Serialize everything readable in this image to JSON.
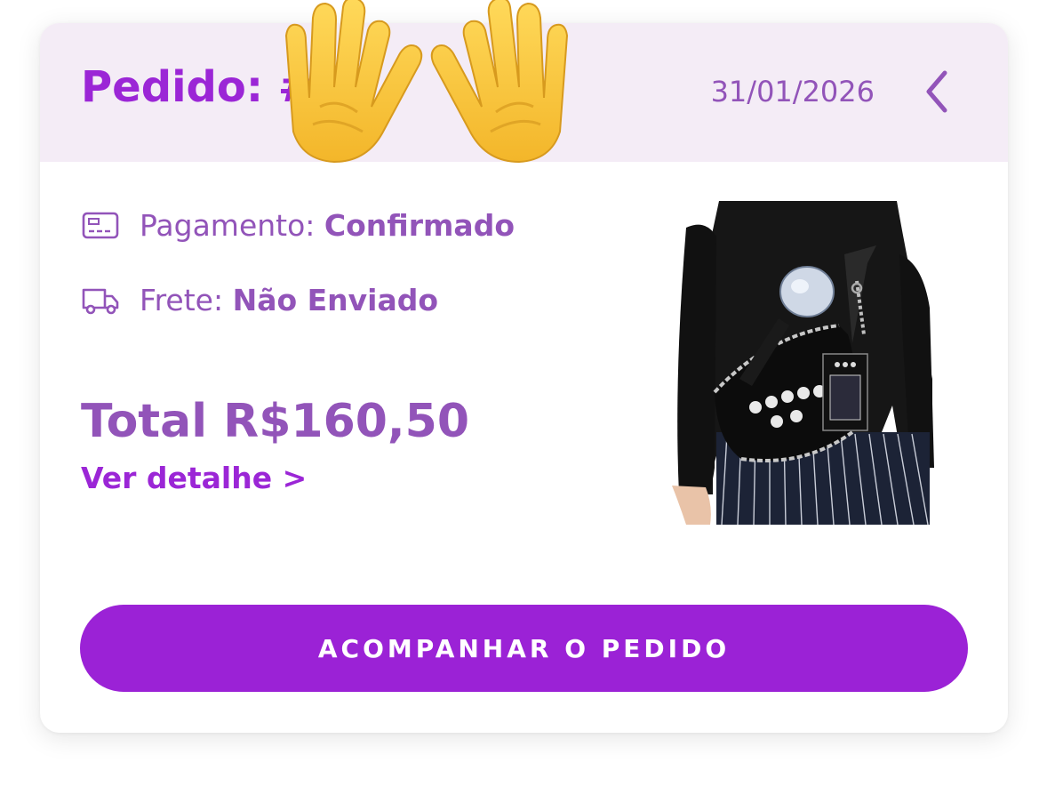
{
  "order": {
    "title": "Pedido: #",
    "date": "31/01/2026"
  },
  "payment": {
    "label": "Pagamento: ",
    "value": "Confirmado",
    "icon": "credit-card-icon"
  },
  "shipping": {
    "label": "Frete: ",
    "value": "Não Enviado",
    "icon": "truck-icon"
  },
  "total": "Total R$160,50",
  "details_link": "Ver detalhe >",
  "track_button": "ACOMPANHAR O PEDIDO",
  "overlay_emoji": "raised-hands-emoji",
  "colors": {
    "brand_purple": "#9b26d6",
    "text_purple": "#9254b9",
    "header_bg": "#f4ecf6",
    "button_bg": "#9b22d6"
  }
}
